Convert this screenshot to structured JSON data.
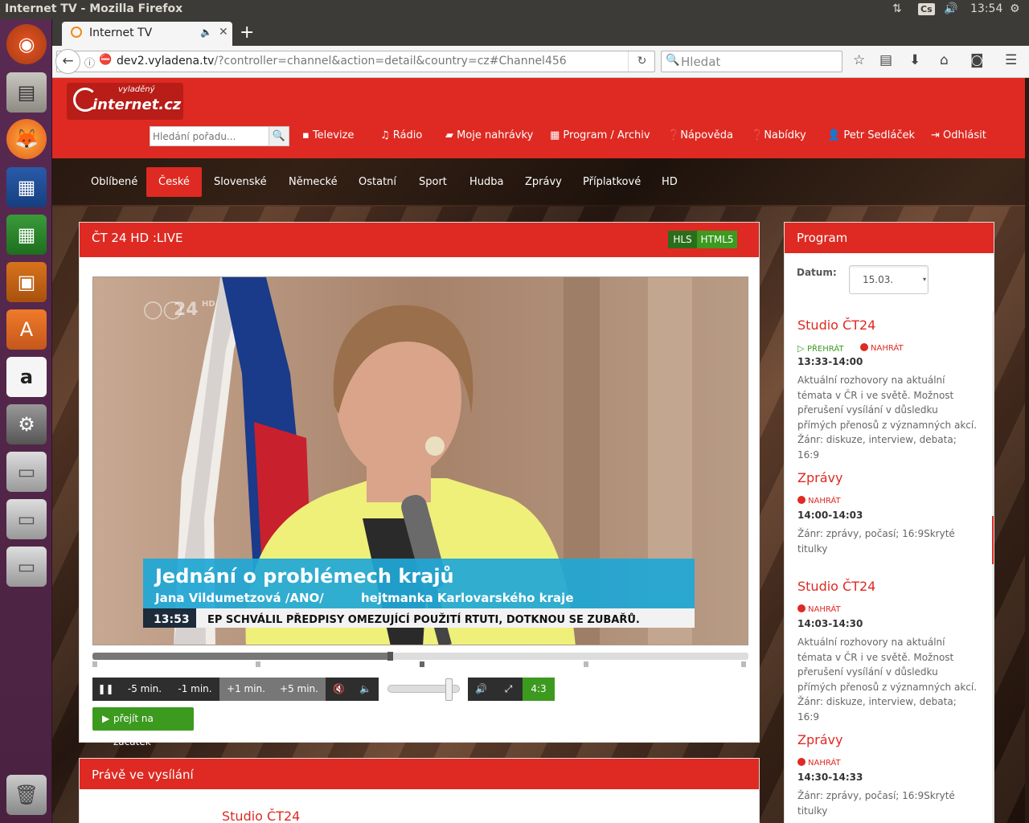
{
  "system": {
    "window_title": "Internet TV - Mozilla Firefox",
    "keyboard": "Cs",
    "clock": "13:54"
  },
  "browser": {
    "tab_title": "Internet TV",
    "url_domain": "dev2.vyladena.tv",
    "url_path": "/?controller=channel&action=detail&country=cz#Channel456",
    "search_placeholder": "Hledat"
  },
  "site": {
    "logo_top": "vyladěný",
    "logo_main": "internet.cz",
    "search_placeholder": "Hledání pořadu...",
    "nav": [
      {
        "label": "Televize",
        "icon": "tv-icon"
      },
      {
        "label": "Rádio",
        "icon": "music-note-icon"
      },
      {
        "label": "Moje nahrávky",
        "icon": "folder-icon"
      },
      {
        "label": "Program / Archiv",
        "icon": "calendar-icon"
      },
      {
        "label": "Nápověda",
        "icon": "question-icon"
      },
      {
        "label": "Nabídky",
        "icon": "question-icon"
      },
      {
        "label": "Petr Sedláček",
        "icon": "user-icon"
      },
      {
        "label": "Odhlásit",
        "icon": "logout-icon"
      }
    ],
    "categories": [
      "Oblíbené",
      "České",
      "Slovenské",
      "Německé",
      "Ostatní",
      "Sport",
      "Hudba",
      "Zprávy",
      "Příplatkové",
      "HD"
    ],
    "active_category": "České"
  },
  "player": {
    "channel_title": "ČT 24 HD  :LIVE",
    "format_hls": "HLS",
    "format_html5": "HTML5",
    "video_logo": "24",
    "video_logo_hd": "HD",
    "caption_title": "Jednání o problémech krajů",
    "caption_name": "Jana Vildumetzová  /ANO/",
    "caption_role": "hejtmanka Karlovarského kraje",
    "caption_time": "13:53",
    "caption_ticker": "EP SCHVÁLIL PŘEDPISY OMEZUJÍCÍ POUŽITÍ RTUTI, DOTKNOU SE ZUBAŘŮ.",
    "progress": 0.45,
    "volume": 0.85,
    "controls": {
      "pause_icon": "pause-icon",
      "minus5": "-5 min.",
      "minus1": "-1 min.",
      "plus1": "+1 min.",
      "plus5": "+5 min.",
      "aspect": "4:3"
    },
    "goto_start": "přejít na začátek"
  },
  "now_playing": {
    "title": "Právě ve vysílání",
    "show": "Studio ČT24"
  },
  "program": {
    "title": "Program",
    "date_label": "Datum:",
    "date_value": "15.03.",
    "items": [
      {
        "title": "Studio ČT24",
        "play_label": "PŘEHRÁT",
        "record_label": "NAHRÁT",
        "time": "13:33-14:00",
        "desc": "Aktuální rozhovory na aktuální témata v ČR i ve světě. Možnost přerušení vysílání v důsledku přímých přenosů z významných akcí. Žánr: diskuze, interview, debata; 16:9"
      },
      {
        "title": "Zprávy",
        "record_label": "NAHRÁT",
        "time": "14:00-14:03",
        "desc": "Žánr: zprávy, počasí; 16:9Skryté titulky"
      },
      {
        "title": "Studio ČT24",
        "record_label": "NAHRÁT",
        "time": "14:03-14:30",
        "desc": "Aktuální rozhovory na aktuální témata v ČR i ve světě. Možnost přerušení vysílání v důsledku přímých přenosů z významných akcí. Žánr: diskuze, interview, debata; 16:9"
      },
      {
        "title": "Zprávy",
        "record_label": "NAHRÁT",
        "time": "14:30-14:33",
        "desc": "Žánr: zprávy, počasí; 16:9Skryté titulky"
      }
    ]
  }
}
